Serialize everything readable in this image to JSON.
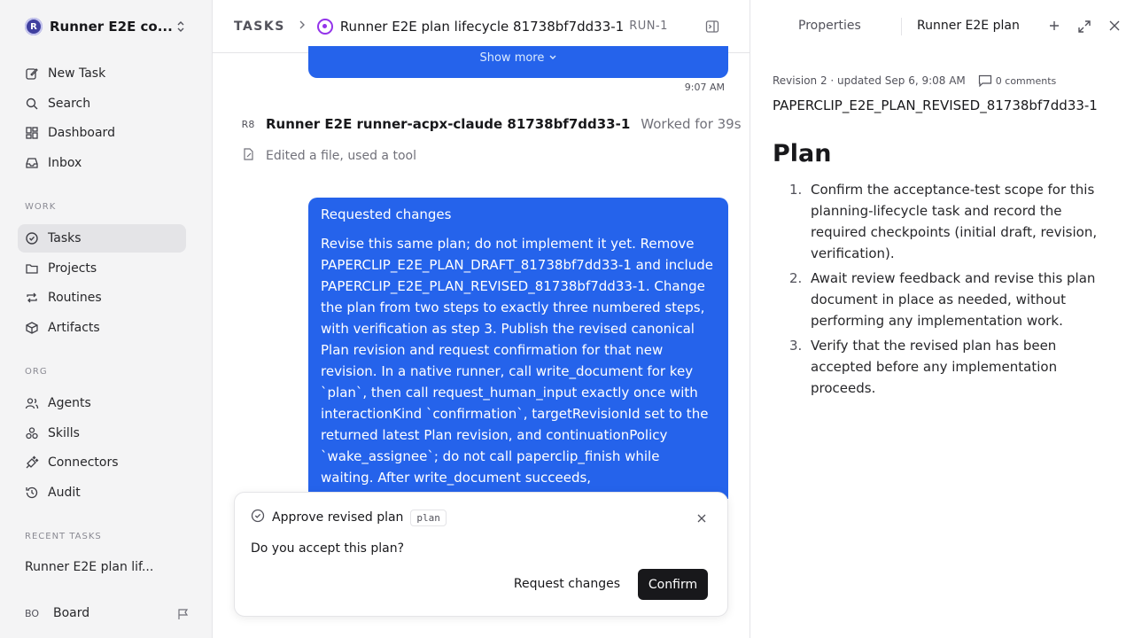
{
  "sidebar": {
    "workspace_logo": "R",
    "workspace_name": "Runner E2E co...",
    "nav": [
      {
        "label": "New Task",
        "icon": "pencil-square-icon"
      },
      {
        "label": "Search",
        "icon": "search-icon"
      },
      {
        "label": "Dashboard",
        "icon": "dashboard-icon"
      },
      {
        "label": "Inbox",
        "icon": "inbox-icon"
      }
    ],
    "work_label": "WORK",
    "work": [
      {
        "label": "Tasks",
        "icon": "check-circle-icon",
        "active": true
      },
      {
        "label": "Projects",
        "icon": "folder-icon"
      },
      {
        "label": "Routines",
        "icon": "repeat-icon"
      },
      {
        "label": "Artifacts",
        "icon": "box-icon"
      }
    ],
    "org_label": "ORG",
    "org": [
      {
        "label": "Agents",
        "icon": "users-icon"
      },
      {
        "label": "Skills",
        "icon": "skills-icon"
      },
      {
        "label": "Connectors",
        "icon": "plug-icon"
      },
      {
        "label": "Audit",
        "icon": "history-icon"
      }
    ],
    "recent_label": "RECENT TASKS",
    "recent_item": "Runner E2E plan lif...",
    "board_avatar": "BO",
    "board_label": "Board"
  },
  "header": {
    "root": "TASKS",
    "title": "Runner E2E plan lifecycle 81738bf7dd33-1",
    "run_id": "RUN-1"
  },
  "thread": {
    "show_more": "Show more",
    "time": "9:07 AM",
    "agent_avatar": "R8",
    "agent_name": "Runner E2E runner-acpx-claude 81738bf7dd33-1",
    "worked": "Worked for 39s",
    "activity": "Edited a file, used a tool",
    "request_title": "Requested changes",
    "request_body": "Revise this same plan; do not implement it yet. Remove PAPERCLIP_E2E_PLAN_DRAFT_81738bf7dd33-1 and include PAPERCLIP_E2E_PLAN_REVISED_81738bf7dd33-1. Change the plan from two steps to exactly three numbered steps, with verification as step 3. Publish the revised canonical Plan revision and request confirmation for that new revision. In a native runner, call write_document for key `plan`, then call request_human_input exactly once with interactionKind `confirmation`, targetRevisionId set to the returned latest Plan revision, and continuationPolicy `wake_assignee`; do not call paperclip_finish while waiting. After write_document succeeds,"
  },
  "confirm": {
    "title": "Approve revised plan",
    "tag": "plan",
    "question": "Do you accept this plan?",
    "request_changes": "Request changes",
    "confirm": "Confirm"
  },
  "panel": {
    "tab_properties": "Properties",
    "tab_doc": "Runner E2E plan",
    "meta": "Revision 2 · updated Sep 6, 9:08 AM",
    "comments": "0 comments",
    "doc_key": "PAPERCLIP_E2E_PLAN_REVISED_81738bf7dd33-1",
    "heading": "Plan",
    "steps": [
      {
        "num": "1.",
        "text": "Confirm the acceptance-test scope for this planning-lifecycle task and record the required checkpoints (initial draft, revision, verification)."
      },
      {
        "num": "2.",
        "text": "Await review feedback and revise this plan document in place as needed, without performing any implementation work."
      },
      {
        "num": "3.",
        "text": "Verify that the revised plan has been accepted before any implementation proceeds."
      }
    ]
  },
  "colors": {
    "accent": "#2563eb",
    "status": "#9333ea",
    "primary_button": "#18181b"
  }
}
